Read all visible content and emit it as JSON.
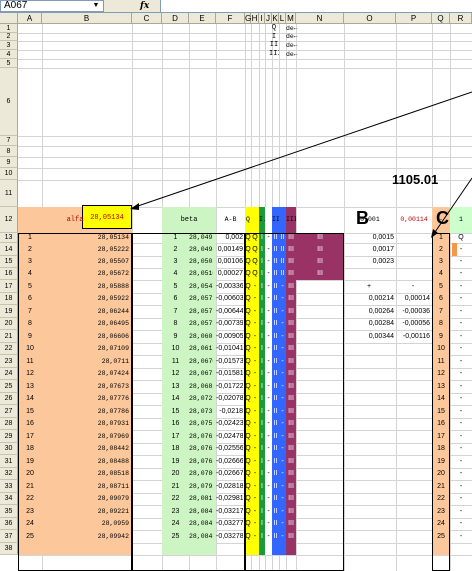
{
  "name_box": "A067",
  "formula_label": "fx",
  "columns": [
    "A",
    "B",
    "C",
    "D",
    "E",
    "F",
    "G",
    "H",
    "I",
    "J",
    "K",
    "L",
    "M",
    "N",
    "O",
    "P",
    "Q",
    "R"
  ],
  "rows": [
    "1",
    "2",
    "3",
    "4",
    "5",
    "6",
    "7",
    "8",
    "9",
    "10",
    "11",
    "12",
    "13",
    "14",
    "15",
    "16",
    "17",
    "18",
    "19",
    "20",
    "21",
    "22",
    "23",
    "24",
    "25",
    "26",
    "27",
    "28",
    "29",
    "30",
    "31",
    "32",
    "33",
    "34",
    "35",
    "36",
    "37",
    "38"
  ],
  "legend": [
    {
      "sym": "Q",
      "text": "de←"
    },
    {
      "sym": "I",
      "text": "de←"
    },
    {
      "sym": "II",
      "text": "de←"
    },
    {
      "sym": "III",
      "text": "de←"
    }
  ],
  "label_1105": "1105.01",
  "label_B": "B",
  "label_C": "C",
  "yellow_value": "28,05134",
  "headers": {
    "alfa": "alfa",
    "beta": "beta",
    "ab": "A-B",
    "q": "Q",
    "i": "I.",
    "ii": "II.",
    "iii": "III.",
    "o": "0,001",
    "p": "0,00114",
    "q_col": "-",
    "r": "1"
  },
  "colors": {
    "orange": "#fcc89b",
    "green": "#cdf5c3",
    "yellow": "#ffff00",
    "qgreen": "#1a9a3a",
    "blue": "#3366ff",
    "maroon": "#993366",
    "orange_strong": "#f79646"
  },
  "alfa": [
    "28,05134",
    "28,05222",
    "28,05507",
    "28,05672",
    "28,05888",
    "28,05922",
    "28,06244",
    "28,06495",
    "28,06606",
    "28,07109",
    "28,0711",
    "28,07424",
    "28,07673",
    "28,07776",
    "28,07786",
    "28,07931",
    "28,07969",
    "28,08442",
    "28,08488",
    "28,08518",
    "28,08711",
    "28,09079",
    "28,09221",
    "28,0959",
    "28,09942"
  ],
  "beta": [
    "28,04934",
    "28,04985",
    "28,05028",
    "28,05105",
    "28,0547",
    "28,05725",
    "28,05778",
    "28,05735",
    "28,06039",
    "28,06175",
    "28,06707",
    "28,06715",
    "28,06856",
    "28,07212",
    "28,07314",
    "28,07557",
    "28,07612",
    "28,07622",
    "28,07681",
    "28,07801",
    "28,07952",
    "28,08115",
    "28,08431",
    "28,08411",
    "28,08431"
  ],
  "ab": [
    "0,002",
    "0,00149",
    "0,00106",
    "0,00027",
    "-0,00336",
    "-0,00603",
    "-0,00644",
    "-0,00739",
    "-0,00905",
    "-0,01041",
    "-0,01573",
    "-0,01581",
    "-0,01722",
    "-0,02078",
    "-0,0218",
    "-0,02423",
    "-0,02478",
    "-0,02556",
    "-0,02666",
    "-0,02667",
    "-0,02818",
    "-0,02981",
    "-0,03217",
    "-0,03277",
    "-0,03278"
  ],
  "o_col": [
    "0,0015",
    "0,0017",
    "0,0023",
    "",
    "+",
    "0,00214",
    "0,00264",
    "0,00284",
    "0,00344"
  ],
  "p_col": [
    "",
    "",
    "",
    "",
    "-",
    "0,00014",
    "-0,00036",
    "-0,00056",
    "-0,00116"
  ]
}
